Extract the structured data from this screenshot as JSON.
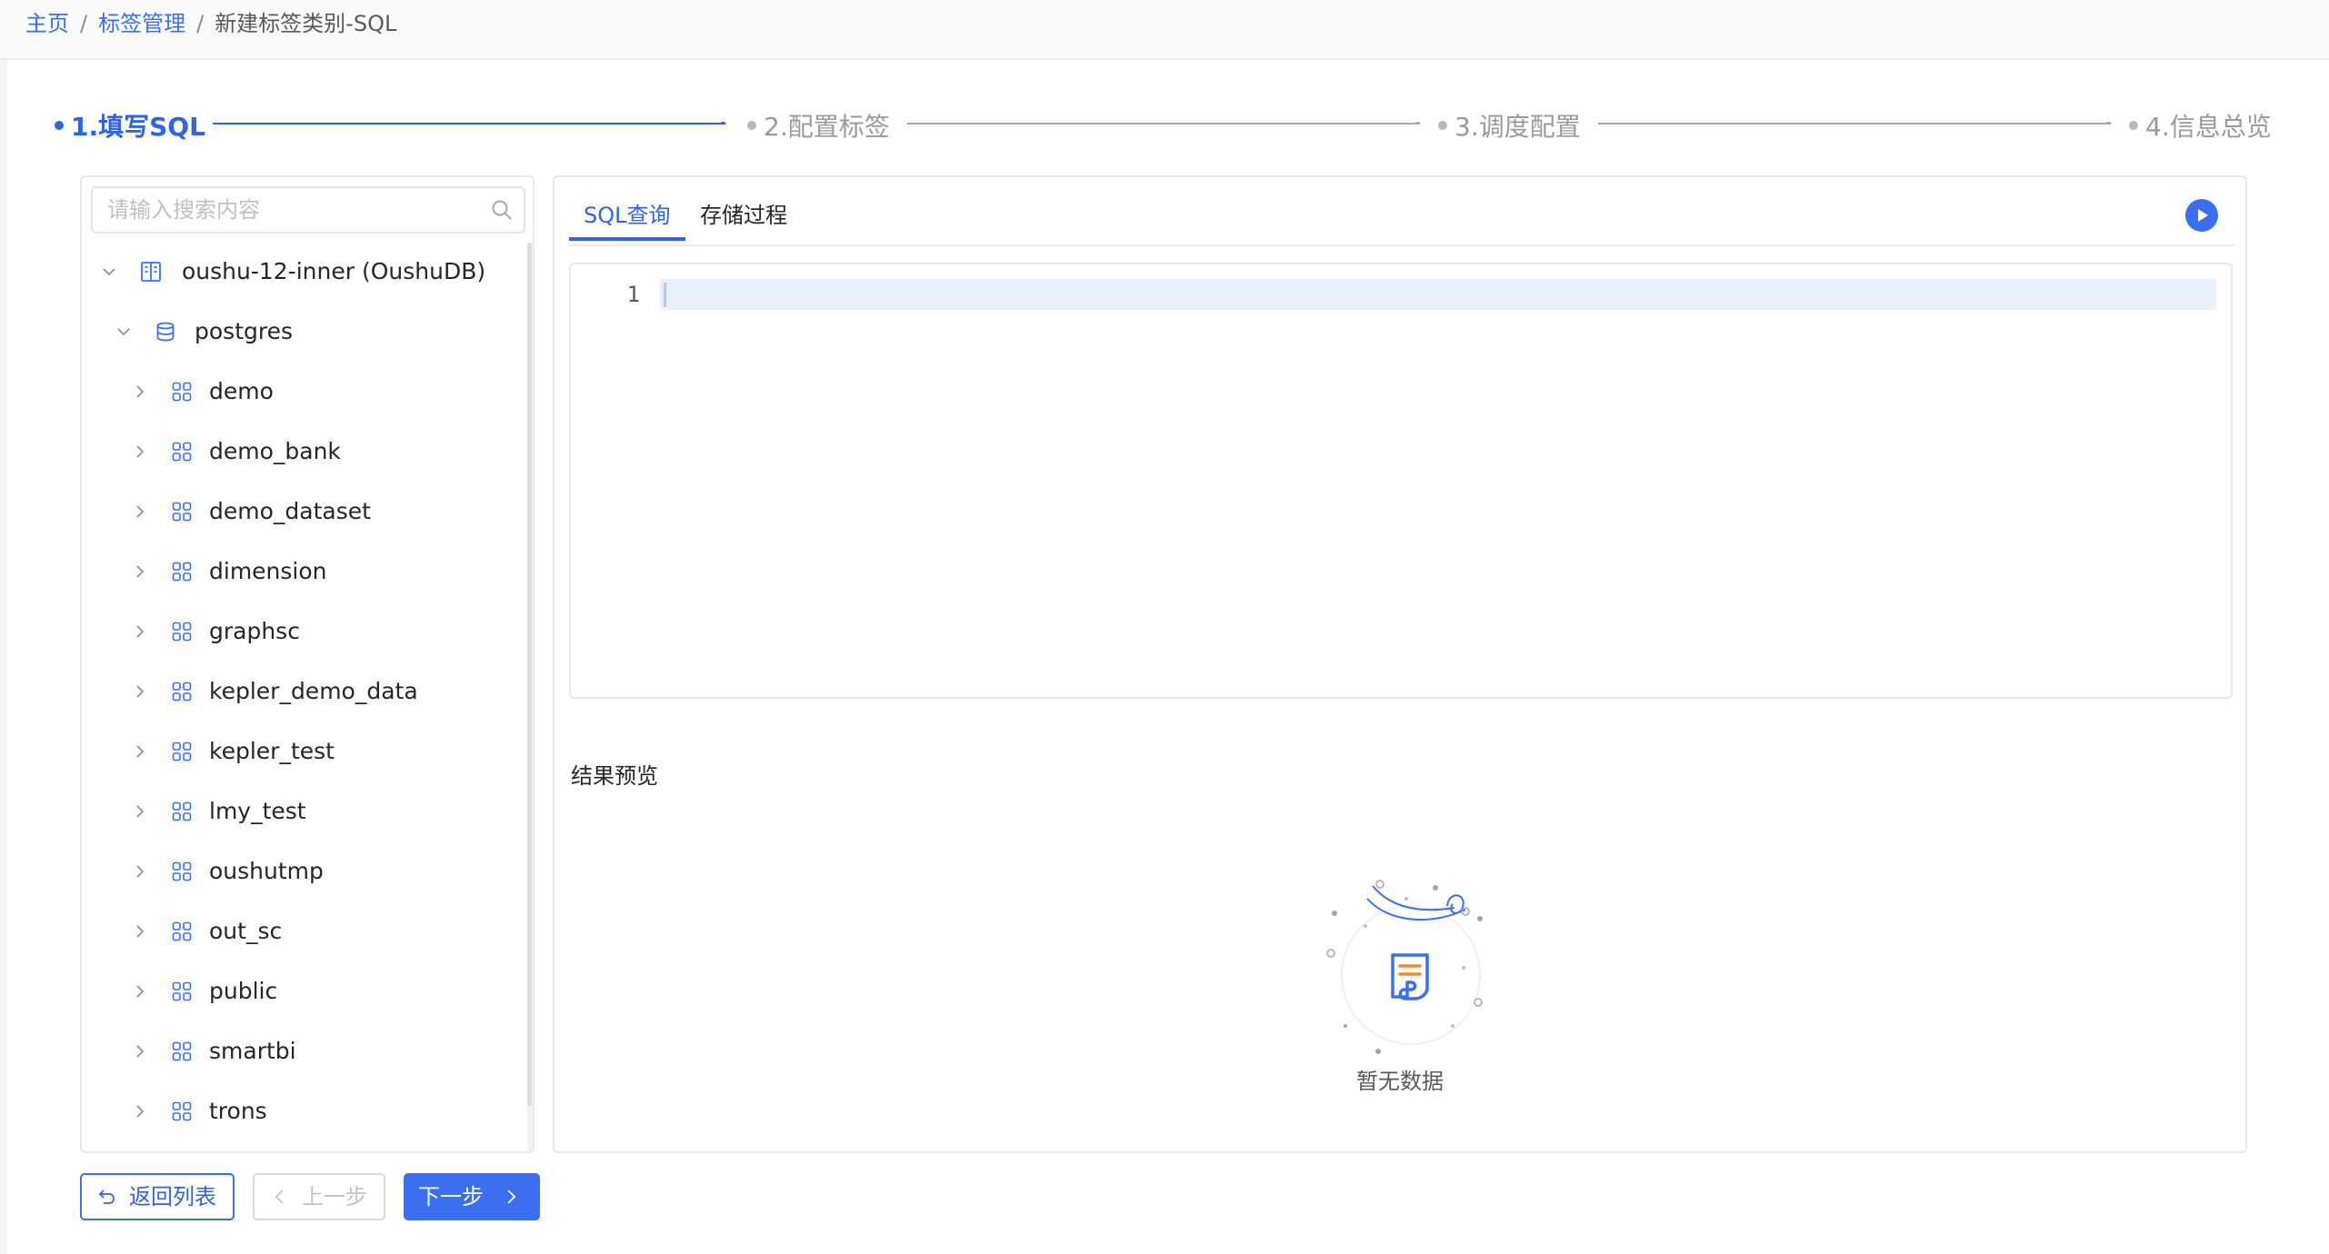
{
  "breadcrumb": {
    "home": "主页",
    "tag_management": "标签管理",
    "current": "新建标签类别-SQL",
    "separator": "/"
  },
  "steps": [
    {
      "label": "1.填写SQL",
      "state": "active"
    },
    {
      "label": "2.配置标签",
      "state": "pending"
    },
    {
      "label": "3.调度配置",
      "state": "pending"
    },
    {
      "label": "4.信息总览",
      "state": "pending"
    }
  ],
  "tree": {
    "search_placeholder": "请输入搜索内容",
    "datasource": {
      "label": "oushu-12-inner (OushuDB)",
      "icon": "datasource-icon",
      "expanded": true
    },
    "database": {
      "label": "postgres",
      "icon": "database-icon",
      "expanded": true
    },
    "schemas": [
      {
        "label": "demo"
      },
      {
        "label": "demo_bank"
      },
      {
        "label": "demo_dataset"
      },
      {
        "label": "dimension"
      },
      {
        "label": "graphsc"
      },
      {
        "label": "kepler_demo_data"
      },
      {
        "label": "kepler_test"
      },
      {
        "label": "lmy_test"
      },
      {
        "label": "oushutmp"
      },
      {
        "label": "out_sc"
      },
      {
        "label": "public"
      },
      {
        "label": "smartbi"
      },
      {
        "label": "trons"
      }
    ]
  },
  "editor": {
    "tabs": [
      {
        "label": "SQL查询",
        "active": true
      },
      {
        "label": "存储过程",
        "active": false
      }
    ],
    "run_icon": "play-icon",
    "line_numbers": [
      "1"
    ],
    "content": ""
  },
  "result": {
    "title": "结果预览",
    "empty_text": "暂无数据"
  },
  "footer": {
    "back_label": "返回列表",
    "prev_label": "上一步",
    "next_label": "下一步"
  },
  "colors": {
    "primary": "#3a6ff2",
    "active_line": "#e9f1fd",
    "border": "#e8e8e8"
  }
}
